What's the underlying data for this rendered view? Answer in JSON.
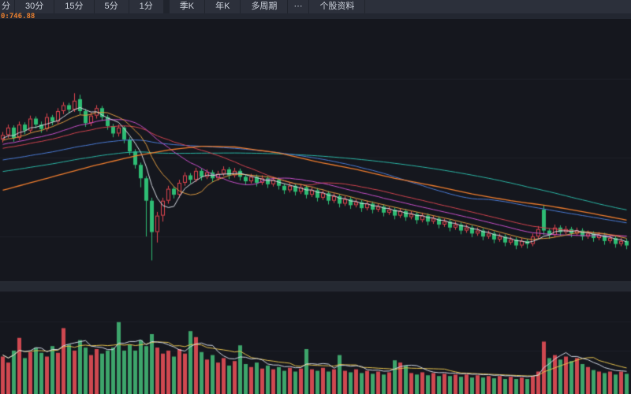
{
  "toolbar": {
    "tabs": [
      {
        "name": "tab-60min-partial",
        "label": "分"
      },
      {
        "name": "tab-30min",
        "label": "30分"
      },
      {
        "name": "tab-15min",
        "label": "15分"
      },
      {
        "name": "tab-5min",
        "label": "5分"
      },
      {
        "name": "tab-1min",
        "label": "1分"
      },
      {
        "name": "tab-quarter-k",
        "label": "季K"
      },
      {
        "name": "tab-year-k",
        "label": "年K"
      },
      {
        "name": "tab-multi-period",
        "label": "多周期"
      },
      {
        "name": "tab-more",
        "label": "⋯"
      },
      {
        "name": "tab-stock-info",
        "label": "个股资料"
      }
    ]
  },
  "overlay": {
    "ma_label": "0:746.88",
    "ma_label_color": "#e87f2f"
  },
  "colors": {
    "background": "#15171e",
    "toolbar_bg": "#2c303b",
    "toolbar_text": "#ccd1db",
    "candle_up_red": "#e0454e",
    "candle_down_green": "#2ebd74",
    "volume_red": "#cf4850",
    "volume_green": "#3da56b",
    "divider": "#252932",
    "long_ma_orange": "#ef7d2e"
  },
  "chart_data": {
    "type": "candlestick",
    "title": "",
    "xlabel": "",
    "ylabel": "",
    "ylim": [
      640,
      1000
    ],
    "panes": [
      "price",
      "volume"
    ],
    "candles": [
      [
        830,
        840,
        826,
        836
      ],
      [
        836,
        850,
        832,
        846
      ],
      [
        846,
        849,
        827,
        832
      ],
      [
        832,
        854,
        829,
        850
      ],
      [
        850,
        853,
        837,
        842
      ],
      [
        842,
        862,
        839,
        858
      ],
      [
        858,
        861,
        845,
        850
      ],
      [
        850,
        854,
        839,
        844
      ],
      [
        844,
        865,
        841,
        860
      ],
      [
        860,
        863,
        849,
        854
      ],
      [
        854,
        872,
        851,
        868
      ],
      [
        868,
        880,
        864,
        876
      ],
      [
        876,
        879,
        865,
        870
      ],
      [
        870,
        892,
        867,
        882
      ],
      [
        884,
        890,
        863,
        868
      ],
      [
        868,
        871,
        847,
        852
      ],
      [
        852,
        866,
        848,
        862
      ],
      [
        862,
        876,
        858,
        872
      ],
      [
        872,
        875,
        855,
        860
      ],
      [
        860,
        863,
        843,
        848
      ],
      [
        848,
        851,
        833,
        838
      ],
      [
        838,
        850,
        834,
        846
      ],
      [
        846,
        848,
        825,
        830
      ],
      [
        830,
        833,
        809,
        814
      ],
      [
        814,
        817,
        791,
        796
      ],
      [
        796,
        799,
        766,
        778
      ],
      [
        778,
        781,
        700,
        748
      ],
      [
        748,
        752,
        668,
        706
      ],
      [
        706,
        733,
        692,
        728
      ],
      [
        728,
        752,
        720,
        748
      ],
      [
        748,
        768,
        744,
        764
      ],
      [
        764,
        767,
        751,
        756
      ],
      [
        756,
        776,
        752,
        772
      ],
      [
        772,
        786,
        768,
        782
      ],
      [
        782,
        785,
        771,
        776
      ],
      [
        776,
        792,
        773,
        788
      ],
      [
        788,
        791,
        775,
        780
      ],
      [
        780,
        790,
        777,
        786
      ],
      [
        786,
        789,
        773,
        778
      ],
      [
        778,
        788,
        775,
        784
      ],
      [
        784,
        794,
        781,
        790
      ],
      [
        790,
        793,
        777,
        782
      ],
      [
        782,
        792,
        779,
        788
      ],
      [
        788,
        791,
        775,
        780
      ],
      [
        780,
        783,
        769,
        774
      ],
      [
        774,
        784,
        771,
        780
      ],
      [
        780,
        783,
        767,
        772
      ],
      [
        772,
        782,
        769,
        778
      ],
      [
        778,
        781,
        765,
        770
      ],
      [
        770,
        780,
        767,
        776
      ],
      [
        776,
        779,
        763,
        768
      ],
      [
        768,
        771,
        757,
        762
      ],
      [
        762,
        772,
        759,
        768
      ],
      [
        768,
        771,
        755,
        760
      ],
      [
        760,
        770,
        757,
        766
      ],
      [
        766,
        769,
        751,
        756
      ],
      [
        756,
        766,
        753,
        762
      ],
      [
        762,
        765,
        747,
        752
      ],
      [
        752,
        762,
        749,
        758
      ],
      [
        758,
        761,
        743,
        748
      ],
      [
        748,
        758,
        745,
        754
      ],
      [
        754,
        757,
        739,
        744
      ],
      [
        744,
        754,
        741,
        750
      ],
      [
        750,
        753,
        737,
        742
      ],
      [
        742,
        750,
        739,
        746
      ],
      [
        746,
        749,
        733,
        738
      ],
      [
        738,
        748,
        735,
        744
      ],
      [
        744,
        747,
        731,
        736
      ],
      [
        736,
        744,
        733,
        740
      ],
      [
        740,
        743,
        727,
        732
      ],
      [
        732,
        740,
        729,
        736
      ],
      [
        736,
        739,
        723,
        728
      ],
      [
        728,
        738,
        725,
        734
      ],
      [
        734,
        737,
        721,
        726
      ],
      [
        726,
        734,
        723,
        730
      ],
      [
        730,
        733,
        717,
        722
      ],
      [
        722,
        732,
        719,
        728
      ],
      [
        728,
        731,
        715,
        720
      ],
      [
        720,
        728,
        717,
        724
      ],
      [
        724,
        727,
        711,
        716
      ],
      [
        716,
        724,
        713,
        720
      ],
      [
        720,
        723,
        707,
        712
      ],
      [
        712,
        720,
        709,
        716
      ],
      [
        716,
        719,
        703,
        708
      ],
      [
        708,
        716,
        705,
        712
      ],
      [
        712,
        715,
        699,
        704
      ],
      [
        704,
        712,
        701,
        708
      ],
      [
        708,
        711,
        695,
        700
      ],
      [
        700,
        708,
        697,
        704
      ],
      [
        704,
        707,
        691,
        696
      ],
      [
        696,
        704,
        693,
        700
      ],
      [
        700,
        703,
        687,
        692
      ],
      [
        692,
        700,
        689,
        696
      ],
      [
        696,
        699,
        683,
        688
      ],
      [
        688,
        698,
        685,
        694
      ],
      [
        694,
        697,
        684,
        690
      ],
      [
        690,
        704,
        687,
        700
      ],
      [
        700,
        714,
        696,
        710
      ],
      [
        736,
        742,
        702,
        708
      ],
      [
        708,
        711,
        697,
        702
      ],
      [
        702,
        716,
        699,
        712
      ],
      [
        712,
        715,
        701,
        706
      ],
      [
        706,
        714,
        703,
        710
      ],
      [
        710,
        713,
        699,
        704
      ],
      [
        704,
        712,
        701,
        708
      ],
      [
        708,
        711,
        695,
        700
      ],
      [
        700,
        708,
        697,
        704
      ],
      [
        704,
        707,
        693,
        698
      ],
      [
        698,
        706,
        695,
        702
      ],
      [
        702,
        705,
        689,
        694
      ],
      [
        694,
        702,
        691,
        698
      ],
      [
        698,
        701,
        685,
        690
      ],
      [
        690,
        698,
        687,
        694
      ],
      [
        694,
        697,
        683,
        688
      ]
    ],
    "volumes": [
      [
        50,
        "r"
      ],
      [
        42,
        "r"
      ],
      [
        58,
        "g"
      ],
      [
        75,
        "r"
      ],
      [
        48,
        "g"
      ],
      [
        56,
        "r"
      ],
      [
        62,
        "g"
      ],
      [
        55,
        "g"
      ],
      [
        50,
        "r"
      ],
      [
        64,
        "g"
      ],
      [
        55,
        "r"
      ],
      [
        88,
        "r"
      ],
      [
        66,
        "g"
      ],
      [
        58,
        "r"
      ],
      [
        72,
        "g"
      ],
      [
        62,
        "g"
      ],
      [
        52,
        "r"
      ],
      [
        60,
        "r"
      ],
      [
        54,
        "g"
      ],
      [
        58,
        "g"
      ],
      [
        62,
        "g"
      ],
      [
        96,
        "g"
      ],
      [
        58,
        "g"
      ],
      [
        66,
        "g"
      ],
      [
        58,
        "g"
      ],
      [
        72,
        "g"
      ],
      [
        64,
        "g"
      ],
      [
        80,
        "g"
      ],
      [
        62,
        "r"
      ],
      [
        54,
        "r"
      ],
      [
        58,
        "r"
      ],
      [
        50,
        "g"
      ],
      [
        60,
        "r"
      ],
      [
        54,
        "r"
      ],
      [
        84,
        "g"
      ],
      [
        76,
        "r"
      ],
      [
        56,
        "g"
      ],
      [
        46,
        "r"
      ],
      [
        52,
        "g"
      ],
      [
        42,
        "r"
      ],
      [
        48,
        "r"
      ],
      [
        38,
        "g"
      ],
      [
        44,
        "r"
      ],
      [
        65,
        "g"
      ],
      [
        40,
        "g"
      ],
      [
        36,
        "r"
      ],
      [
        42,
        "g"
      ],
      [
        34,
        "r"
      ],
      [
        38,
        "g"
      ],
      [
        33,
        "r"
      ],
      [
        36,
        "g"
      ],
      [
        31,
        "g"
      ],
      [
        35,
        "r"
      ],
      [
        30,
        "g"
      ],
      [
        34,
        "r"
      ],
      [
        60,
        "g"
      ],
      [
        33,
        "r"
      ],
      [
        31,
        "g"
      ],
      [
        35,
        "r"
      ],
      [
        30,
        "g"
      ],
      [
        33,
        "r"
      ],
      [
        52,
        "g"
      ],
      [
        31,
        "r"
      ],
      [
        29,
        "g"
      ],
      [
        33,
        "r"
      ],
      [
        28,
        "g"
      ],
      [
        31,
        "r"
      ],
      [
        27,
        "g"
      ],
      [
        30,
        "r"
      ],
      [
        26,
        "g"
      ],
      [
        29,
        "r"
      ],
      [
        45,
        "g"
      ],
      [
        42,
        "r"
      ],
      [
        38,
        "g"
      ],
      [
        28,
        "r"
      ],
      [
        26,
        "g"
      ],
      [
        29,
        "r"
      ],
      [
        25,
        "g"
      ],
      [
        28,
        "r"
      ],
      [
        24,
        "g"
      ],
      [
        27,
        "r"
      ],
      [
        24,
        "g"
      ],
      [
        26,
        "r"
      ],
      [
        23,
        "g"
      ],
      [
        26,
        "r"
      ],
      [
        22,
        "g"
      ],
      [
        25,
        "r"
      ],
      [
        22,
        "g"
      ],
      [
        24,
        "r"
      ],
      [
        21,
        "g"
      ],
      [
        24,
        "r"
      ],
      [
        20,
        "g"
      ],
      [
        23,
        "r"
      ],
      [
        20,
        "g"
      ],
      [
        22,
        "r"
      ],
      [
        20,
        "g"
      ],
      [
        24,
        "r"
      ],
      [
        30,
        "r"
      ],
      [
        70,
        "r"
      ],
      [
        48,
        "g"
      ],
      [
        52,
        "r"
      ],
      [
        46,
        "g"
      ],
      [
        50,
        "r"
      ],
      [
        44,
        "g"
      ],
      [
        48,
        "r"
      ],
      [
        40,
        "g"
      ],
      [
        36,
        "r"
      ],
      [
        32,
        "g"
      ],
      [
        30,
        "r"
      ],
      [
        28,
        "g"
      ],
      [
        30,
        "r"
      ],
      [
        26,
        "g"
      ],
      [
        30,
        "r"
      ],
      [
        27,
        "g"
      ]
    ],
    "price_mas": [
      {
        "window": 90,
        "color": "#2ab6a5"
      },
      {
        "window": 60,
        "color": "#4a7bd5"
      },
      {
        "window": 30,
        "color": "#d2434e"
      },
      {
        "window": 20,
        "color": "#c84fca"
      },
      {
        "window": 10,
        "color": "#df9b40"
      },
      {
        "window": 5,
        "color": "#d6dae2"
      }
    ],
    "long_ma": {
      "color": "#ef7d2e",
      "points": [
        [
          0,
          762
        ],
        [
          8,
          778
        ],
        [
          16,
          794
        ],
        [
          24,
          808
        ],
        [
          30,
          816
        ],
        [
          36,
          821
        ],
        [
          42,
          820
        ],
        [
          50,
          812
        ],
        [
          57,
          800
        ],
        [
          64,
          790
        ],
        [
          71,
          778
        ],
        [
          78,
          768
        ],
        [
          85,
          757
        ],
        [
          92,
          748
        ],
        [
          99,
          741
        ],
        [
          106,
          732
        ],
        [
          113,
          722
        ]
      ]
    },
    "volume_mas": [
      {
        "window": 10,
        "color": "#e3c04c"
      },
      {
        "window": 5,
        "color": "#cfd6e4"
      }
    ],
    "prehistory": {
      "start": 740,
      "end": 832,
      "steps": 90
    },
    "legend_position": "none",
    "grid": "faint"
  }
}
